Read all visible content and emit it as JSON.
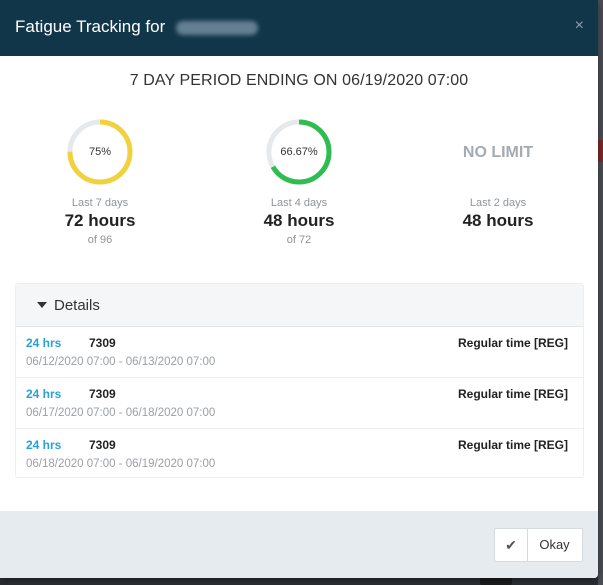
{
  "modal": {
    "title": "Fatigue Tracking for",
    "close_glyph": "×"
  },
  "period": {
    "heading": "7 DAY PERIOD ENDING ON 06/19/2020 07:00"
  },
  "stats": [
    {
      "type": "donut",
      "percent_label": "75%",
      "percent": 75,
      "color": "#f2d13c",
      "caption": "Last 7 days",
      "hours": "72 hours",
      "of": "of 96"
    },
    {
      "type": "donut",
      "percent_label": "66.67%",
      "percent": 66.67,
      "color": "#2ebd4e",
      "caption": "Last 4 days",
      "hours": "48 hours",
      "of": "of 72"
    },
    {
      "type": "nolimit",
      "label": "NO LIMIT",
      "caption": "Last 2 days",
      "hours": "48 hours"
    }
  ],
  "details": {
    "label": "Details",
    "rows": [
      {
        "hrs": "24 hrs",
        "id": "7309",
        "type": "Regular time [REG]",
        "range": "06/12/2020 07:00 - 06/13/2020 07:00"
      },
      {
        "hrs": "24 hrs",
        "id": "7309",
        "type": "Regular time [REG]",
        "range": "06/17/2020 07:00 - 06/18/2020 07:00"
      },
      {
        "hrs": "24 hrs",
        "id": "7309",
        "type": "Regular time [REG]",
        "range": "06/18/2020 07:00 - 06/19/2020 07:00"
      }
    ]
  },
  "footer": {
    "okay_label": "Okay",
    "check_glyph": "✔"
  },
  "colors": {
    "header_bg": "#11364a",
    "accent_blue": "#2aa1d6",
    "donut_track": "#e6e9ec"
  }
}
